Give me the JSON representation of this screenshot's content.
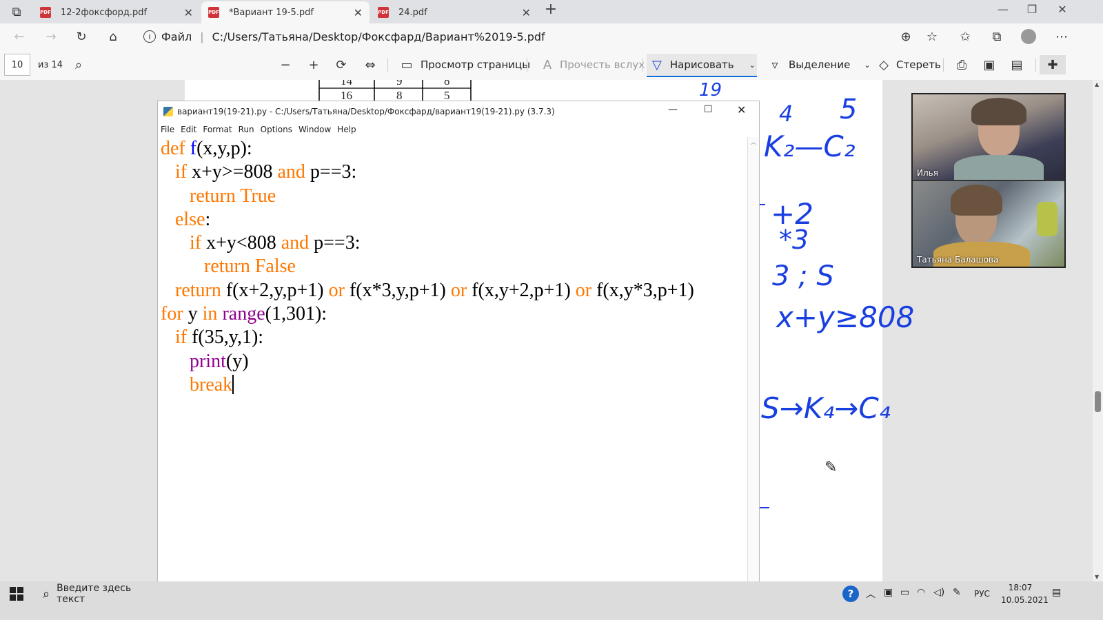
{
  "browser": {
    "tabs": [
      {
        "label": "12-2фоксфорд.pdf",
        "icon": "pdf-icon",
        "active": false
      },
      {
        "label": "*Вариант 19-5.pdf",
        "icon": "pdf-icon",
        "active": true
      },
      {
        "label": "24.pdf",
        "icon": "pdf-icon",
        "active": false
      }
    ],
    "address": {
      "prefix": "Файл",
      "url": "C:/Users/Татьяна/Desktop/Фоксфард/Вариант%2019-5.pdf"
    }
  },
  "pdf_toolbar": {
    "page_current": "10",
    "page_total": "из 14",
    "page_view_label": "Просмотр страницы",
    "read_aloud_label": "Прочесть вслух",
    "draw_label": "Нарисовать",
    "highlight_label": "Выделение",
    "erase_label": "Стереть"
  },
  "pdf_page": {
    "table_rows": [
      [
        "14",
        "9",
        "8"
      ],
      [
        "16",
        "8",
        "5"
      ]
    ],
    "handwriting": [
      "19",
      "4",
      "5",
      "K₂—C₂",
      "+2",
      "*3",
      "3 ; S",
      "x+y≥808",
      "S→K₄→C₄"
    ]
  },
  "idle": {
    "title": "вариант19(19-21).py - C:/Users/Татьяна/Desktop/Фоксфард/вариант19(19-21).py (3.7.3)",
    "menu": [
      "File",
      "Edit",
      "Format",
      "Run",
      "Options",
      "Window",
      "Help"
    ],
    "code": {
      "l1": {
        "kw": "def",
        "fn": "f",
        "rest": "(x,y,p):"
      },
      "l2": {
        "kw1": "if",
        "mid": " x+y>=808 ",
        "kw2": "and",
        "rest": " p==3:"
      },
      "l3": {
        "kw": "return True"
      },
      "l4": {
        "kw": "else",
        "rest": ":"
      },
      "l5": {
        "kw1": "if",
        "mid": " x+y<808 ",
        "kw2": "and",
        "rest": " p==3:"
      },
      "l6": {
        "kw": "return False"
      },
      "l7": {
        "kw": "return",
        "a": " f(x+2,y,p+1) ",
        "or1": "or",
        "b": " f(x*3,y,p+1) ",
        "or2": "or",
        "c": " f(x,y+2,p+1) ",
        "or3": "or",
        "d": " f(x,y*3,p+1)"
      },
      "l8": {
        "kw1": "for",
        "mid": " y ",
        "kw2": "in",
        "sp": " ",
        "bi": "range",
        "rest": "(1,301):"
      },
      "l9": {
        "kw": "if",
        "rest": " f(35,y,1):"
      },
      "l10": {
        "bi": "print",
        "rest": "(y)"
      },
      "l11": {
        "kw": "break"
      }
    }
  },
  "video": {
    "participants": [
      {
        "name": "Илья"
      },
      {
        "name": "Татьяна Балашова"
      }
    ]
  },
  "taskbar": {
    "search_placeholder": "Введите здесь текст",
    "lang": "РУС",
    "time": "18:07",
    "date": "10.05.2021"
  },
  "colors": {
    "keyword": "#ff7700",
    "function_name": "#0000ff",
    "builtin": "#900090",
    "ink": "#1a3fe0",
    "accent": "#0a6cd6"
  }
}
